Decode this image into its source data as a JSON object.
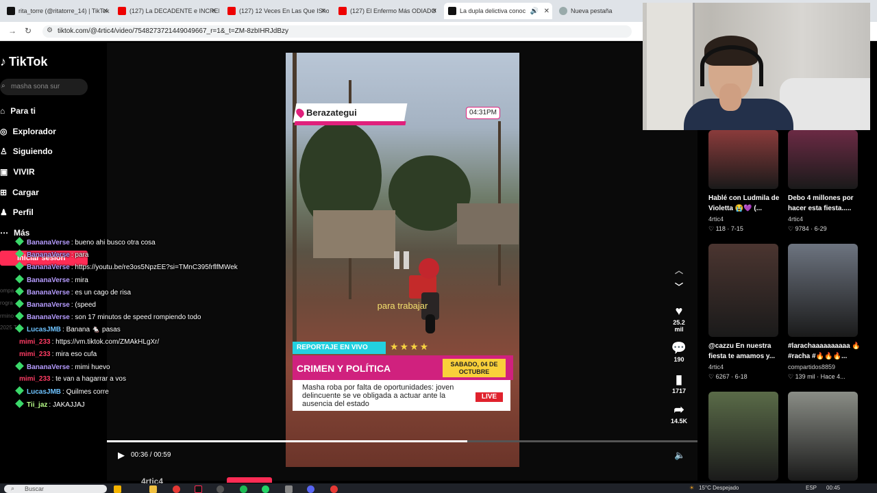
{
  "browser": {
    "tabs": [
      {
        "title": "rita_torre (@ritatorre_14) | TikTok",
        "favicon": "tiktok-icon"
      },
      {
        "title": "(127) La DECADENTE e INCREIBLE",
        "favicon": "youtube-icon"
      },
      {
        "title": "(127) 12 Veces En Las Que IShow",
        "favicon": "youtube-icon"
      },
      {
        "title": "(127) El Enfermo Más ODIADO",
        "favicon": "youtube-icon"
      },
      {
        "title": "La dupla delictiva conoc",
        "favicon": "tiktok-icon",
        "active": true
      },
      {
        "title": "Nueva pestaña",
        "favicon": "new-tab-icon"
      }
    ],
    "url": "tiktok.com/@4rtic4/video/7548273721449049667_r=1&_t=ZM-8zbIHRJdBzy"
  },
  "tiktok": {
    "logo": "TikTok",
    "search_placeholder": "masha sona sur",
    "sidebar": [
      {
        "label": "Para ti",
        "icon": "home-icon"
      },
      {
        "label": "Explorador",
        "icon": "compass-icon"
      },
      {
        "label": "Siguiendo",
        "icon": "following-icon"
      },
      {
        "label": "VIVIR",
        "icon": "live-icon"
      },
      {
        "label": "Cargar",
        "icon": "upload-icon"
      },
      {
        "label": "Perfil",
        "icon": "profile-icon"
      },
      {
        "label": "Más",
        "icon": "more-icon"
      }
    ],
    "login_label": "Iniciar sesión",
    "faded_lines": [
      "ompa",
      "rogra",
      "rmino",
      "2025 T"
    ]
  },
  "video": {
    "location": "Berazategui",
    "clock": "04:31PM",
    "subtitle": "para trabajar",
    "report_label": "REPORTAJE EN VIVO",
    "stars": "★★★★",
    "section_title": "CRIMEN Y POLÍTICA",
    "date_line1": "SABADO, 04 DE",
    "date_line2": "OCTUBRE",
    "headline": "Masha roba por falta de oportunidades: joven delincuente se ve obligada a actuar ante la ausencia del estado",
    "live_badge": "LIVE",
    "progress": 0.61,
    "time_current": "00:36",
    "time_total": "00:59",
    "time_display": "00:36 / 00:59",
    "author_peek": "4rtic4"
  },
  "actions": {
    "likes": "25.2",
    "likes_unit": "mil",
    "comments": "190",
    "saves": "1717",
    "shares": "14.5K"
  },
  "chat": [
    {
      "nick": "BananaVerse",
      "msg": ": bueno ahi busco otra cosa",
      "color": "#b69cff",
      "badge": true
    },
    {
      "nick": "BananaVerse",
      "msg": ": para",
      "color": "#b69cff",
      "badge": true
    },
    {
      "nick": "BananaVerse",
      "msg": ": https://youtu.be/re3os5NpzEE?si=TMnC395frflfMWek",
      "color": "#b69cff",
      "badge": true
    },
    {
      "nick": "BananaVerse",
      "msg": ": mira",
      "color": "#b69cff",
      "badge": true
    },
    {
      "nick": "BananaVerse",
      "msg": ": es un cago de risa",
      "color": "#b69cff",
      "badge": true
    },
    {
      "nick": "BananaVerse",
      "msg": ": (speed",
      "color": "#b69cff",
      "badge": true
    },
    {
      "nick": "BananaVerse",
      "msg": ": son 17 minutos de speed rompiendo todo",
      "color": "#b69cff",
      "badge": true
    },
    {
      "nick": "LucasJMB",
      "msg": ": Banana 🐁 pasas",
      "color": "#6ec3ff",
      "badge": true
    },
    {
      "nick": "mimi_233",
      "msg": ": https://vm.tiktok.com/ZMAkHLgXr/",
      "color": "#ff3c64",
      "badge": false
    },
    {
      "nick": "mimi_233",
      "msg": ": mira eso cufa",
      "color": "#ff3c64",
      "badge": false
    },
    {
      "nick": "BananaVerse",
      "msg": ": mimi huevo",
      "color": "#b69cff",
      "badge": true
    },
    {
      "nick": "mimi_233",
      "msg": ": te van a hagarrar a vos",
      "color": "#ff3c64",
      "badge": false
    },
    {
      "nick": "LucasJMB",
      "msg": ": Quilmes corre",
      "color": "#6ec3ff",
      "badge": true
    },
    {
      "nick": "Tii_jaz",
      "msg": ": JAKAJJAJ",
      "color": "#b8ff8a",
      "badge": true
    }
  ],
  "grid": [
    {
      "title": "Hablé con Ludmila de Violetta 😭💜 (...",
      "author": "4rtic4",
      "stats": "♡ 118 · 7-15",
      "thumb": "#8a3b3b"
    },
    {
      "title": "Debo 4 millones por hacer esta fiesta.....",
      "author": "4rtic4",
      "stats": "♡ 9784 · 6-29",
      "thumb": "#6b2a44"
    },
    {
      "title": "@cazzu En nuestra fiesta te amamos y...",
      "author": "4rtic4",
      "stats": "♡ 6267 · 6-18",
      "thumb": "#4b3530"
    },
    {
      "title": "#larachaaaaaaaaaa 🔥 #racha #🔥🔥🔥...",
      "author": "compartidos8859",
      "stats": "♡ 139 mil · Hace 4...",
      "thumb": "#6d7480"
    },
    {
      "title": "",
      "author": "",
      "stats": "",
      "thumb": "#5a6b48"
    },
    {
      "title": "",
      "author": "",
      "stats": "",
      "thumb": "#8a8d86"
    }
  ],
  "taskbar": {
    "search_label": "Buscar",
    "weather": "15°C Despejado",
    "lang": "ESP",
    "time": "00:45"
  }
}
